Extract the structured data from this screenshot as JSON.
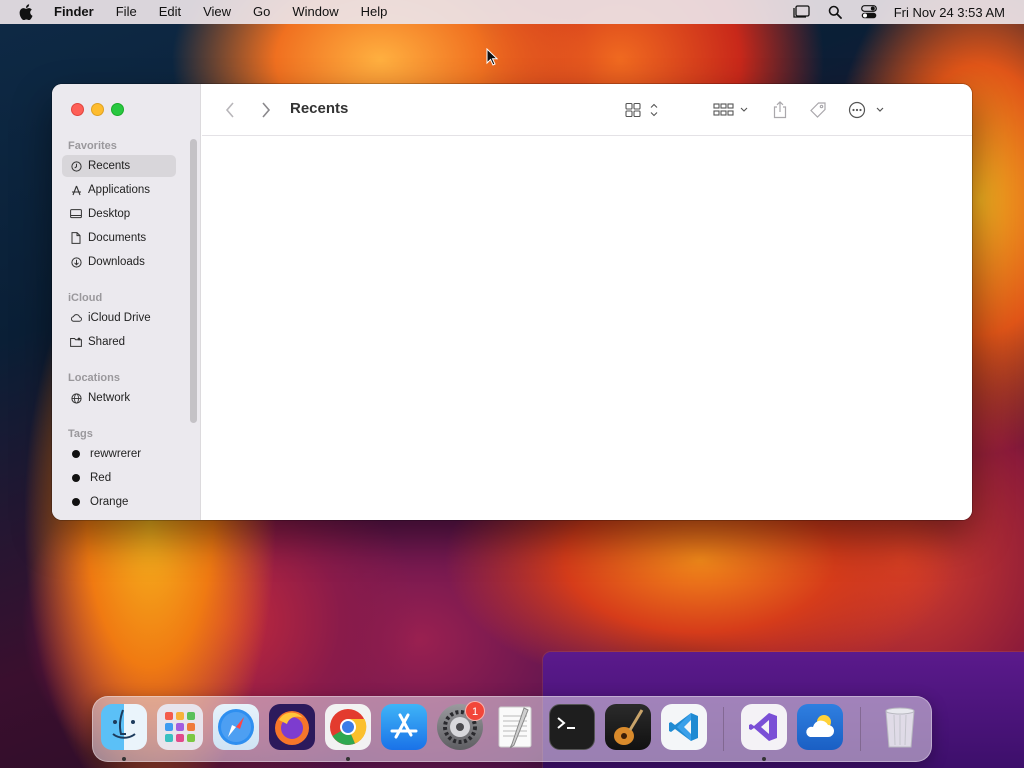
{
  "menubar": {
    "app_name": "Finder",
    "items": [
      "File",
      "Edit",
      "View",
      "Go",
      "Window",
      "Help"
    ],
    "clock": "Fri Nov 24  3:53 AM"
  },
  "finder": {
    "title": "Recents",
    "sidebar": {
      "favorites_header": "Favorites",
      "favorites": [
        "Recents",
        "Applications",
        "Desktop",
        "Documents",
        "Downloads"
      ],
      "icloud_header": "iCloud",
      "icloud": [
        "iCloud Drive",
        "Shared"
      ],
      "locations_header": "Locations",
      "locations": [
        "Network"
      ],
      "tags_header": "Tags",
      "tags": [
        "rewwrerer",
        "Red",
        "Orange"
      ],
      "selected": "Recents"
    }
  },
  "dock": {
    "apps": [
      "finder",
      "launchpad",
      "safari",
      "firefox",
      "chrome",
      "app-store",
      "system-settings",
      "textedit",
      "terminal",
      "garageband",
      "vscode",
      "visual-studio",
      "weather",
      "trash"
    ],
    "system_settings_badge": "1"
  },
  "colors": {
    "close": "#fe5f57",
    "minimize": "#febc2e",
    "maximize": "#28c840",
    "badge": "#f2463a"
  }
}
